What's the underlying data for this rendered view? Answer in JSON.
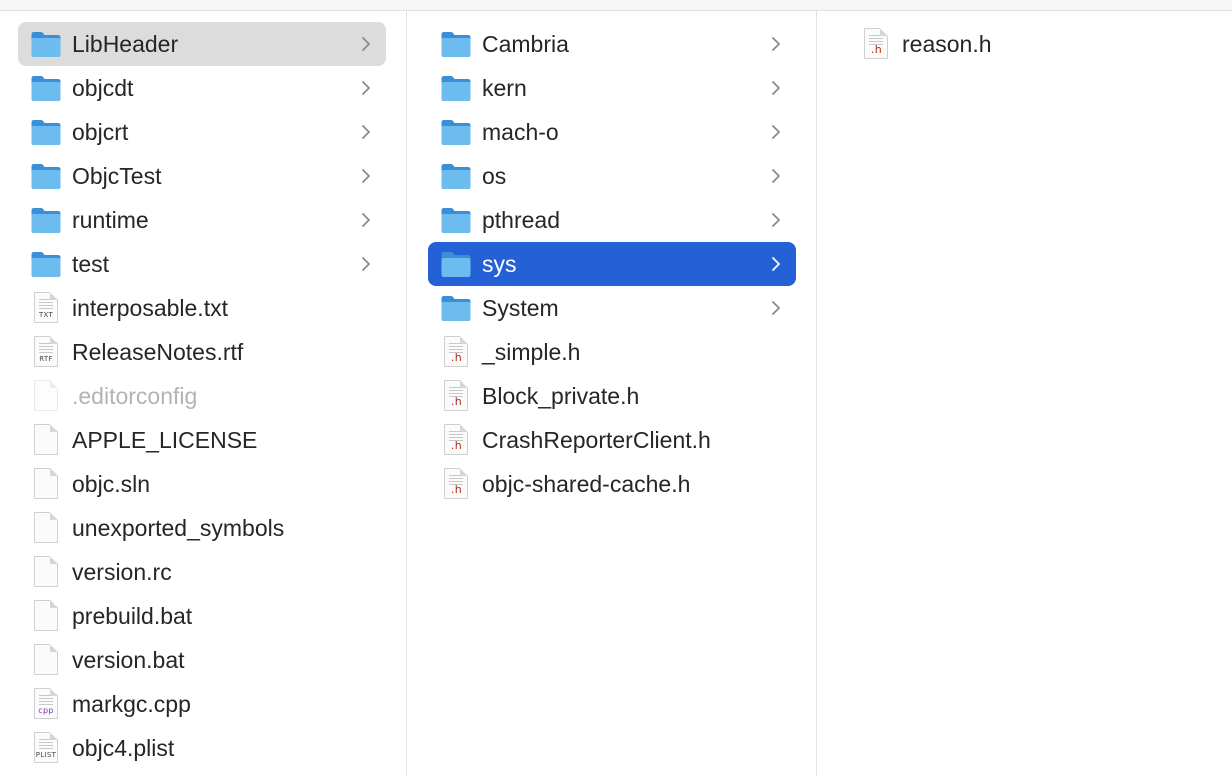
{
  "columns": [
    {
      "items": [
        {
          "name": "LibHeader",
          "kind": "folder",
          "state": "selected-gray"
        },
        {
          "name": "objcdt",
          "kind": "folder"
        },
        {
          "name": "objcrt",
          "kind": "folder"
        },
        {
          "name": "ObjcTest",
          "kind": "folder"
        },
        {
          "name": "runtime",
          "kind": "folder"
        },
        {
          "name": "test",
          "kind": "folder"
        },
        {
          "name": "interposable.txt",
          "kind": "file",
          "badge": "TXT"
        },
        {
          "name": "ReleaseNotes.rtf",
          "kind": "file",
          "badge": "RTF"
        },
        {
          "name": ".editorconfig",
          "kind": "file",
          "state": "dimmed"
        },
        {
          "name": "APPLE_LICENSE",
          "kind": "file"
        },
        {
          "name": "objc.sln",
          "kind": "file"
        },
        {
          "name": "unexported_symbols",
          "kind": "file"
        },
        {
          "name": "version.rc",
          "kind": "file"
        },
        {
          "name": "prebuild.bat",
          "kind": "file"
        },
        {
          "name": "version.bat",
          "kind": "file"
        },
        {
          "name": "markgc.cpp",
          "kind": "file",
          "badge": "cpp"
        },
        {
          "name": "objc4.plist",
          "kind": "file",
          "badge": "PLIST"
        }
      ]
    },
    {
      "items": [
        {
          "name": "Cambria",
          "kind": "folder"
        },
        {
          "name": "kern",
          "kind": "folder"
        },
        {
          "name": "mach-o",
          "kind": "folder"
        },
        {
          "name": "os",
          "kind": "folder"
        },
        {
          "name": "pthread",
          "kind": "folder"
        },
        {
          "name": "sys",
          "kind": "folder",
          "state": "selected-blue"
        },
        {
          "name": "System",
          "kind": "folder"
        },
        {
          "name": "_simple.h",
          "kind": "file",
          "badge": ".h"
        },
        {
          "name": "Block_private.h",
          "kind": "file",
          "badge": ".h"
        },
        {
          "name": "CrashReporterClient.h",
          "kind": "file",
          "badge": ".h"
        },
        {
          "name": "objc-shared-cache.h",
          "kind": "file",
          "badge": ".h"
        }
      ]
    },
    {
      "items": [
        {
          "name": "reason.h",
          "kind": "file",
          "badge": ".h"
        }
      ]
    }
  ],
  "colors": {
    "selection_blue": "#2461d6",
    "selection_gray": "#dcdcdc",
    "folder_blue": "#5aaee6"
  }
}
